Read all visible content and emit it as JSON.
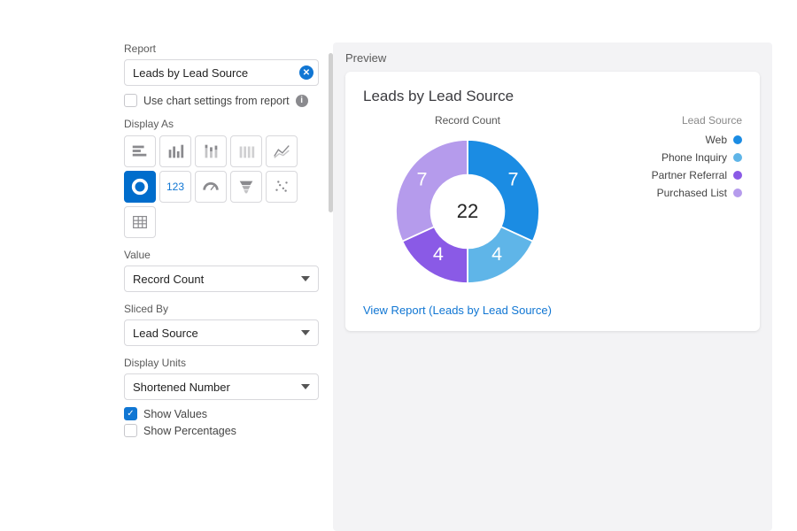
{
  "sidebar": {
    "report_label": "Report",
    "report_value": "Leads by Lead Source",
    "use_report_settings_label": "Use chart settings from report",
    "use_report_settings_checked": false,
    "display_as_label": "Display As",
    "chart_types": [
      {
        "name": "horizontal-bar",
        "selected": false
      },
      {
        "name": "vertical-bar",
        "selected": false
      },
      {
        "name": "stacked-bar",
        "selected": false
      },
      {
        "name": "stacked-bar-alt",
        "selected": false
      },
      {
        "name": "line",
        "selected": false
      },
      {
        "name": "donut",
        "selected": true
      },
      {
        "name": "metric",
        "selected": false,
        "label": "123"
      },
      {
        "name": "gauge",
        "selected": false
      },
      {
        "name": "funnel",
        "selected": false
      },
      {
        "name": "scatter",
        "selected": false
      },
      {
        "name": "table",
        "selected": false
      }
    ],
    "value_label": "Value",
    "value_selected": "Record Count",
    "sliced_by_label": "Sliced By",
    "sliced_by_selected": "Lead Source",
    "display_units_label": "Display Units",
    "display_units_selected": "Shortened Number",
    "show_values_label": "Show Values",
    "show_values_checked": true,
    "show_percentages_label": "Show Percentages",
    "show_percentages_checked": false
  },
  "preview": {
    "section_label": "Preview",
    "title": "Leads by Lead Source",
    "metric_label": "Record Count",
    "total": "22",
    "legend_title": "Lead Source",
    "view_report_link": "View Report (Leads by Lead Source)"
  },
  "chart_data": {
    "type": "pie",
    "title": "Leads by Lead Source",
    "metric": "Record Count",
    "total": 22,
    "series": [
      {
        "name": "Web",
        "value": 7,
        "color": "#1b8ce3"
      },
      {
        "name": "Phone Inquiry",
        "value": 4,
        "color": "#5fb5e8"
      },
      {
        "name": "Partner Referral",
        "value": 4,
        "color": "#8a5ae6"
      },
      {
        "name": "Purchased List",
        "value": 7,
        "color": "#b59bec"
      }
    ]
  }
}
